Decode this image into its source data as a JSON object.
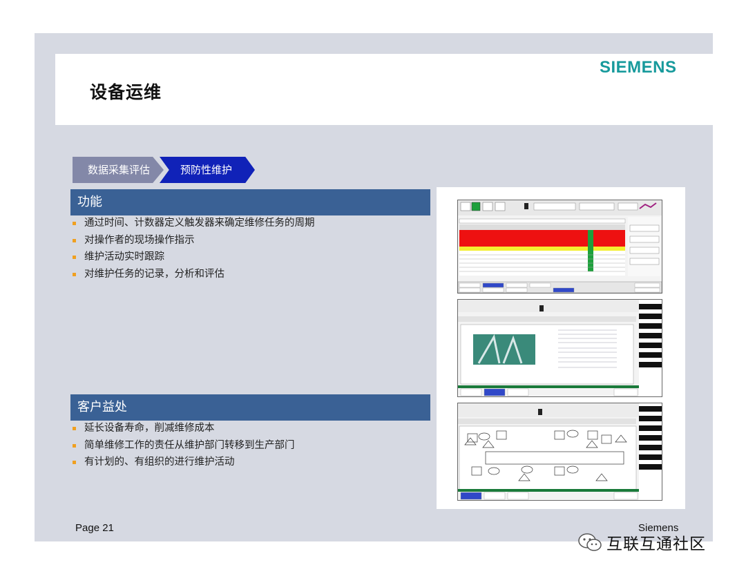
{
  "header": {
    "title": "设备运维",
    "logo": "SIEMENS"
  },
  "breadcrumb": [
    {
      "label": "数据采集评估"
    },
    {
      "label": "预防性维护"
    }
  ],
  "sections": {
    "function": {
      "heading": "功能",
      "items": [
        "通过时间、计数器定义触发器来确定维修任务的周期",
        "对操作者的现场操作指示",
        "维护活动实时跟踪",
        "对维护任务的记录，分析和评估"
      ]
    },
    "benefit": {
      "heading": "客户益处",
      "items": [
        "延长设备寿命，削减维修成本",
        "简单维修工作的责任从维护部门转移到生产部门",
        "有计划的、有组织的进行维护活动"
      ]
    }
  },
  "footer": {
    "page": "Page 21",
    "company": "Siemens"
  },
  "watermark": {
    "text": "互联互通社区",
    "icon": "wechat-icon"
  },
  "colors": {
    "logo": "#179a9c",
    "band": "#3a6195",
    "chevron_inactive": "#8388a8",
    "chevron_active": "#1022b8",
    "bullet": "#f0a020"
  }
}
